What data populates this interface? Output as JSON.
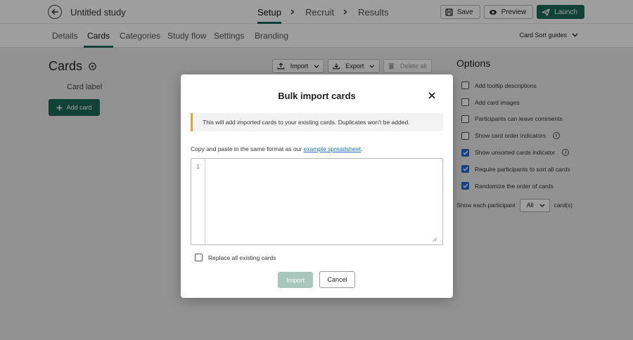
{
  "topbar": {
    "study_title": "Untitled study",
    "steps": [
      "Setup",
      "Recruit",
      "Results"
    ],
    "save_label": "Save",
    "preview_label": "Preview",
    "launch_label": "Launch"
  },
  "subnav": {
    "tabs": [
      "Details",
      "Cards",
      "Categories",
      "Study flow",
      "Settings",
      "Branding"
    ],
    "active_tab": "Cards",
    "guides_label": "Card Sort guides"
  },
  "main": {
    "title": "Cards",
    "column_label": "Card label",
    "add_card_label": "Add card",
    "import_label": "Import",
    "export_label": "Export",
    "delete_all_label": "Delete all"
  },
  "options": {
    "title": "Options",
    "items": [
      {
        "label": "Add tooltip descriptions",
        "checked": false,
        "info": false
      },
      {
        "label": "Add card images",
        "checked": false,
        "info": false
      },
      {
        "label": "Participants can leave comments",
        "checked": false,
        "info": false
      },
      {
        "label": "Show card order indicators",
        "checked": false,
        "info": true
      },
      {
        "label": "Show unsorted cards indicator",
        "checked": true,
        "info": true
      },
      {
        "label": "Require participants to sort all cards",
        "checked": true,
        "info": false
      },
      {
        "label": "Randomize the order of cards",
        "checked": true,
        "info": false
      }
    ],
    "show_each_label": "Show each participant",
    "show_each_value": "All",
    "show_each_suffix": "card(s)"
  },
  "modal": {
    "title": "Bulk import cards",
    "notice": "This will add imported cards to your existing cards. Duplicates won't be added.",
    "copy_prefix": "Copy and paste in the same format as our ",
    "copy_link": "example spreadsheet",
    "copy_suffix": ".",
    "editor_line": "1",
    "replace_label": "Replace all existing cards",
    "replace_checked": false,
    "import_label": "Import",
    "cancel_label": "Cancel"
  },
  "colors": {
    "brand": "#1a6b57",
    "checkbox_on": "#1f6fd1",
    "notice_accent": "#e6a23c"
  }
}
